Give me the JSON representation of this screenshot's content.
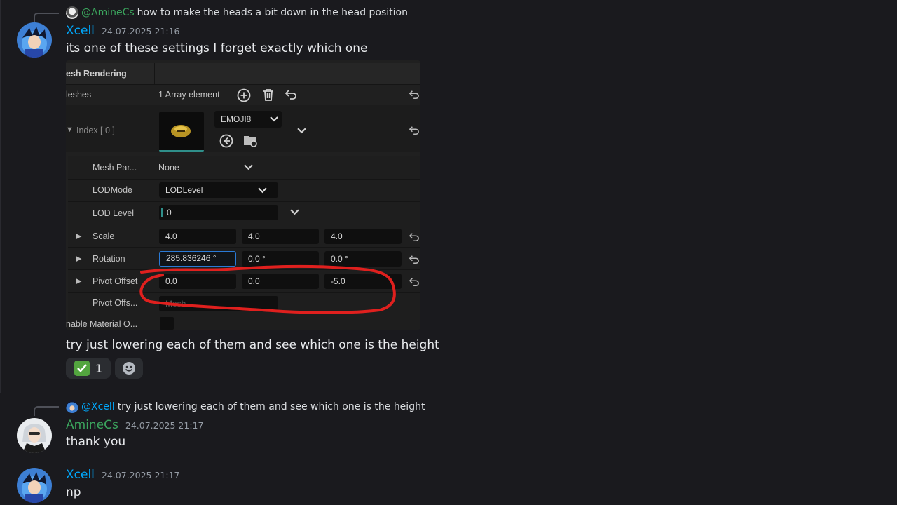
{
  "messages": [
    {
      "reply": {
        "mention": "@AmineCs",
        "text": "how to make the heads a bit down in the head position"
      },
      "author": "Xcell",
      "timestamp": "24.07.2025 21:16",
      "text_before": "its one of these settings I forget exactly which one",
      "text_after": "try just lowering each of them and see which one is the height",
      "reactions": [
        {
          "emoji": "check-mark-icon",
          "count": "1"
        }
      ]
    },
    {
      "reply": {
        "mention": "@Xcell",
        "text": "try just lowering each of them and see which one is the height"
      },
      "author": "AmineCs",
      "timestamp": "24.07.2025 21:17",
      "text": "thank you"
    },
    {
      "author": "Xcell",
      "timestamp": "24.07.2025 21:17",
      "text": "np"
    }
  ],
  "editor": {
    "section": "esh Rendering",
    "meshes_label": "leshes",
    "meshes_value": "1 Array element",
    "index_label": "Index [ 0 ]",
    "mesh_asset": "EMOJI8",
    "rows": [
      {
        "label": "Mesh Par...",
        "value": "None"
      },
      {
        "label": "LODMode",
        "value": "LODLevel"
      },
      {
        "label": "LOD Level",
        "value": "0"
      }
    ],
    "scale": {
      "label": "Scale",
      "x": "4.0",
      "y": "4.0",
      "z": "4.0"
    },
    "rotation": {
      "label": "Rotation",
      "x": "285.836246 °",
      "y": "0.0 °",
      "z": "0.0 °"
    },
    "pivot_offset": {
      "label": "Pivot Offset",
      "x": "0.0",
      "y": "0.0",
      "z": "-5.0"
    },
    "pivot_offs_mode": {
      "label": "Pivot Offs...",
      "value": "Mesh"
    },
    "enable_material": {
      "label": "nable Material O..."
    }
  },
  "colors": {
    "link_blue": "#00a8fc",
    "green_name": "#3ba55d",
    "highlight_red": "#e0201e"
  }
}
